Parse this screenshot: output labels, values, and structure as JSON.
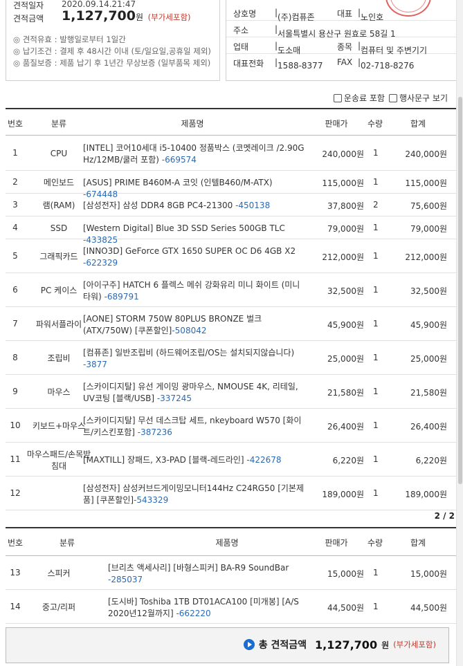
{
  "estimate": {
    "date_label": "견적일자",
    "date_value": "2020.09.14.21:47",
    "amount_label": "견적금액",
    "amount_value": "1,127,700",
    "amount_unit": "원",
    "vat_label": "(부가세포함)",
    "notes": [
      "◎ 견적유효 : 발행일로부터 1일간",
      "◎ 납기조건 : 결제 후 48시간 이내 (토/일요일,공휴일 제외)",
      "◎ 품질보증 : 제품 납기 후 1년간 무상보증 (일부품목 제외)"
    ]
  },
  "seller": {
    "company_label": "상호명",
    "company_value": "(주)컴퓨존",
    "ceo_label": "대표",
    "ceo_value": "노인호",
    "address_label": "주소",
    "address_value": "서울특별시 용산구 원효로 58길 1",
    "biztype_label": "업태",
    "biztype_value": "도소매",
    "bizitem_label": "종목",
    "bizitem_value": "컴퓨터 및 주변기기",
    "phone_label": "대표전화",
    "phone_value": "1588-8377",
    "fax_label": "FAX",
    "fax_value": "02-718-8276"
  },
  "options": {
    "shipping_label": "운송료 포함",
    "phrase_label": "행사문구 보기"
  },
  "table": {
    "headers": {
      "no": "번호",
      "category": "분류",
      "name": "제품명",
      "price": "판매가",
      "qty": "수량",
      "sum": "합계"
    },
    "page_indicator": "2 / 2",
    "rows": [
      {
        "no": "1",
        "cat": "CPU",
        "name": "[INTEL] 코어10세대 i5-10400 정품박스 (코멧레이크 /2.90G Hz/12MB/쿨러 포함) ",
        "code": "-669574",
        "price": "240,000원",
        "qty": "1",
        "sum": "240,000원"
      },
      {
        "no": "2",
        "cat": "메인보드",
        "name": "[ASUS] PRIME B460M-A 코잇 (인텔B460/M-ATX) ",
        "code": "-674448",
        "price": "115,000원",
        "qty": "1",
        "sum": "115,000원"
      },
      {
        "no": "3",
        "cat": "램(RAM)",
        "name": "[삼성전자] 삼성 DDR4 8GB PC4-21300 ",
        "code": "-450138",
        "price": "37,800원",
        "qty": "2",
        "sum": "75,600원"
      },
      {
        "no": "4",
        "cat": "SSD",
        "name": "[Western Digital] Blue 3D SSD Series 500GB TLC ",
        "code": "-433825",
        "price": "79,000원",
        "qty": "1",
        "sum": "79,000원"
      },
      {
        "no": "5",
        "cat": "그래픽카드",
        "name": "[INNO3D] GeForce GTX 1650 SUPER OC D6 4GB X2 ",
        "code": "-622329",
        "price": "212,000원",
        "qty": "1",
        "sum": "212,000원"
      },
      {
        "no": "6",
        "cat": "PC 케이스",
        "name": "[아이구주] HATCH 6 플렉스 메쉬 강화유리 미니 화이트 (미니타워) ",
        "code": "-689791",
        "price": "32,500원",
        "qty": "1",
        "sum": "32,500원"
      },
      {
        "no": "7",
        "cat": "파워서플라이",
        "name": "[AONE] STORM 750W 80PLUS BRONZE 벌크 (ATX/750W) [쿠폰할인]",
        "code": "-508042",
        "price": "45,900원",
        "qty": "1",
        "sum": "45,900원"
      },
      {
        "no": "8",
        "cat": "조립비",
        "name": "[컴퓨존] 일반조립비 (하드웨어조립/OS는 설치되지않습니다) ",
        "code": "-3877",
        "price": "25,000원",
        "qty": "1",
        "sum": "25,000원"
      },
      {
        "no": "9",
        "cat": "마우스",
        "name": "[스카이디지탈] 유선 게이밍 광마우스, NMOUSE 4K, 리테일, UV코팅 [블랙/USB] ",
        "code": "-337245",
        "price": "21,580원",
        "qty": "1",
        "sum": "21,580원"
      },
      {
        "no": "10",
        "cat": "키보드+마우스",
        "name": "[스카이디지탈] 무선 데스크탑 세트, nkeyboard W570 [화이트/키스킨포함] ",
        "code": "-387236",
        "price": "26,400원",
        "qty": "1",
        "sum": "26,400원"
      },
      {
        "no": "11",
        "cat": "마우스패드/손목받침대",
        "name": "[MAXTILL] 장패드, X3-PAD [블랙-레드라인] ",
        "code": "-422678",
        "price": "6,220원",
        "qty": "1",
        "sum": "6,220원"
      },
      {
        "no": "12",
        "cat": "",
        "name": "[삼성전자] 삼성커브드게이밍모니터144Hz C24RG50 [기본제품] [쿠폰할인]",
        "code": "-543329",
        "price": "189,000원",
        "qty": "1",
        "sum": "189,000원"
      }
    ],
    "rows2": [
      {
        "no": "13",
        "cat": "스피커",
        "name": "[브리츠 액세사리] [바형스피커] BA-R9 SoundBar ",
        "code": "-285037",
        "price": "15,000원",
        "qty": "1",
        "sum": "15,000원"
      },
      {
        "no": "14",
        "cat": "중고/리퍼",
        "name": "[도시바] Toshiba 1TB DT01ACA100 [미개봉] [A/S 2020년12월까지] ",
        "code": "-662220",
        "price": "44,500원",
        "qty": "1",
        "sum": "44,500원"
      }
    ]
  },
  "total": {
    "label": "총 견적금액",
    "amount": "1,127,700",
    "unit": "원",
    "vat": "(부가세포함)"
  }
}
